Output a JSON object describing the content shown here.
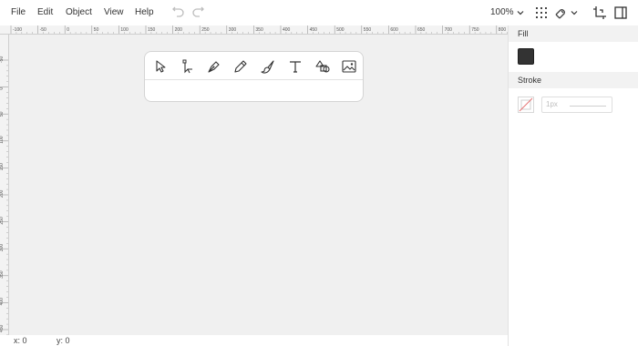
{
  "menu": {
    "items": [
      {
        "label": "File"
      },
      {
        "label": "Edit"
      },
      {
        "label": "Object"
      },
      {
        "label": "View"
      },
      {
        "label": "Help"
      }
    ]
  },
  "toolbar": {
    "zoom": "100%",
    "icons": [
      "undo-icon",
      "redo-icon",
      "grid-icon",
      "snap-magnet-icon",
      "chevron-down-icon",
      "crop-icon",
      "panel-toggle-icon"
    ]
  },
  "rulers": {
    "top_labels": [
      "-100",
      "-50",
      "0",
      "50",
      "100",
      "150",
      "200",
      "250",
      "300",
      "350",
      "400",
      "450",
      "500",
      "550",
      "600",
      "650",
      "700",
      "750",
      "800"
    ],
    "left_labels": [
      "-50",
      "0",
      "50",
      "100",
      "150",
      "200",
      "250",
      "300",
      "350",
      "400",
      "450",
      "500"
    ]
  },
  "tools": [
    "select-tool-icon",
    "direct-select-tool-icon",
    "pen-tool-icon",
    "pencil-tool-icon",
    "brush-tool-icon",
    "text-tool-icon",
    "shapes-tool-icon",
    "image-tool-icon"
  ],
  "sidepanel": {
    "fill_label": "Fill",
    "fill_color": "#333333",
    "stroke_label": "Stroke",
    "stroke_width": "1px"
  },
  "status": {
    "x": "x: 0",
    "y": "y: 0"
  }
}
